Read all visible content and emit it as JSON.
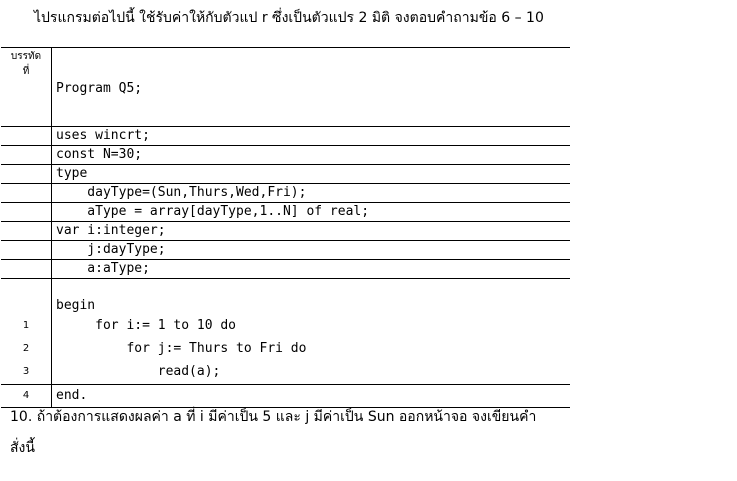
{
  "intro": "ไปรแกรมต่อไปนี้ ใช้รับค่าให้กับตัวแป  r  ซึ่งเป็นตัวแปร  2 มิติ  จงตอบคำถามข้อ   6 – 10",
  "table": {
    "header_num": [
      "บรรทัด",
      "ที่"
    ],
    "header_code": "Program Q5;",
    "rows": [
      {
        "num": "",
        "code": "uses wincrt;"
      },
      {
        "num": "",
        "code": "const N=30;"
      },
      {
        "num": "",
        "code": "type"
      },
      {
        "num": "",
        "code": "    dayType=(Sun,Thurs,Wed,Fri);"
      },
      {
        "num": "",
        "code": "    aType = array[dayType,1..N] of real;"
      },
      {
        "num": "",
        "code": "var i:integer;"
      },
      {
        "num": "",
        "code": "    j:dayType;"
      },
      {
        "num": "",
        "code": "    a:aType;"
      }
    ],
    "block": [
      {
        "num": "",
        "code": "begin"
      },
      {
        "num": "1",
        "code": "     for i:= 1 to 10 do"
      },
      {
        "num": "2",
        "code": "         for j:= Thurs to Fri do"
      },
      {
        "num": "3",
        "code": "             read(a);"
      }
    ],
    "last": {
      "num": "4",
      "code": "end."
    }
  },
  "question": {
    "line1": "10.  ถ้าต้องการแสดงผลค่า a ที่ i มีค่าเป็น  5 และ  j มีค่าเป็น Sun ออกหน้าจอ จงเขียนคำ",
    "line2": "สั่งนี้"
  }
}
